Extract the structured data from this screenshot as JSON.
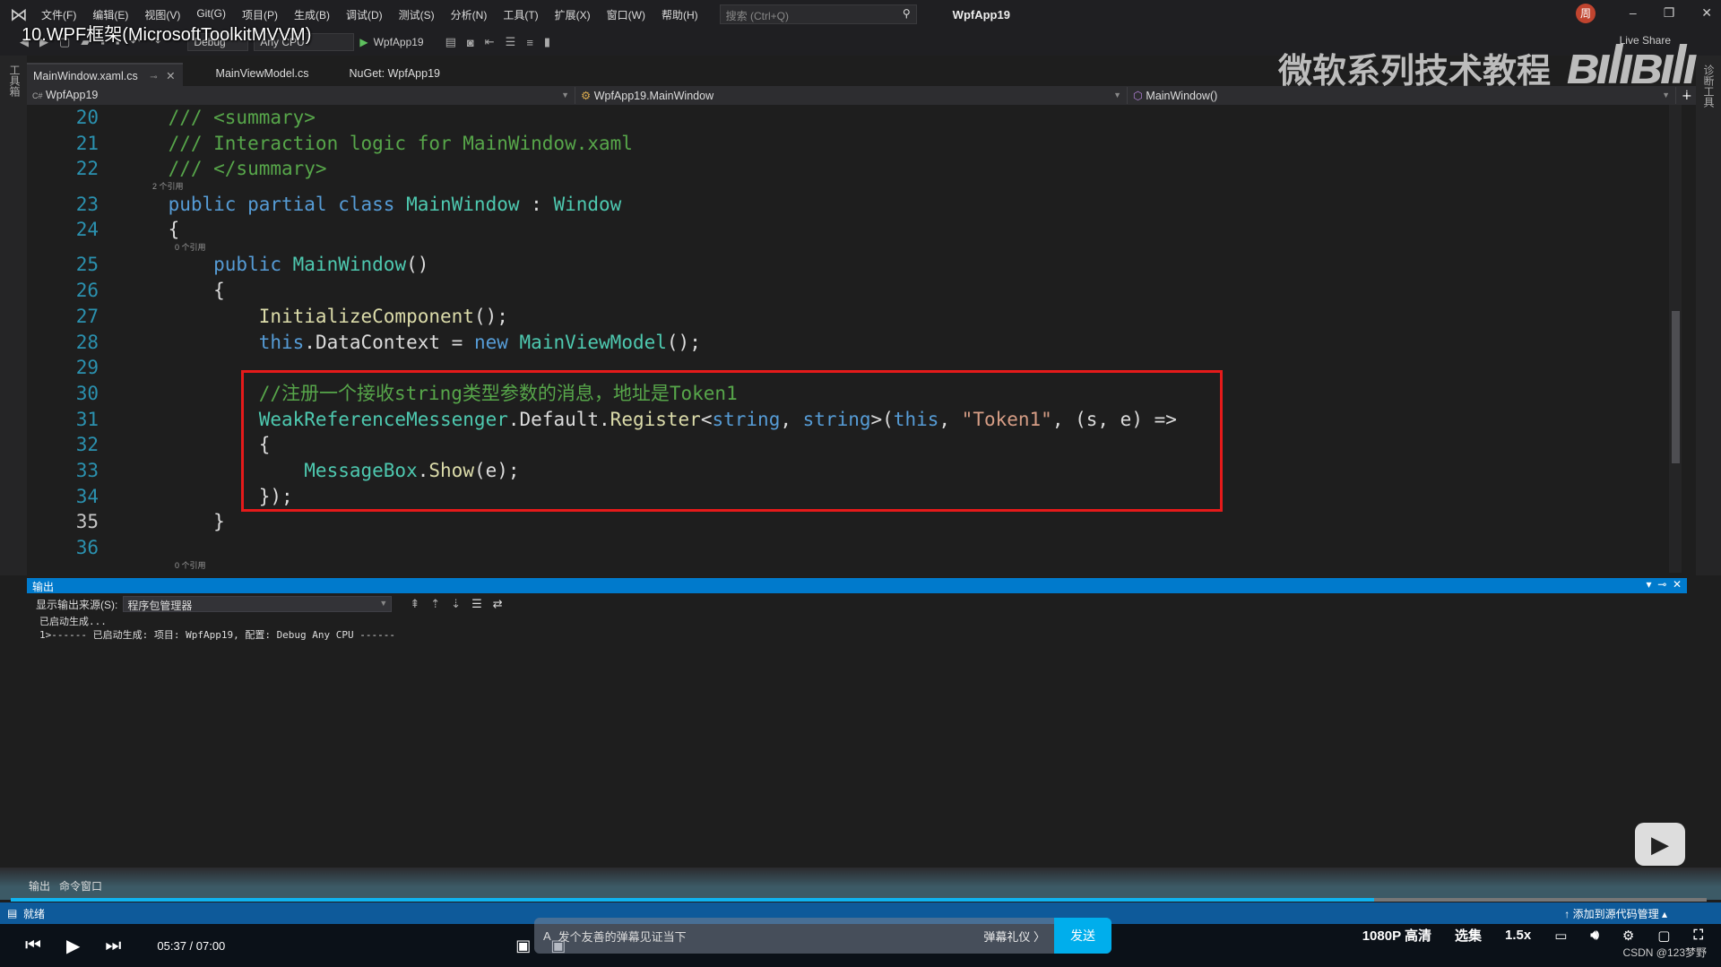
{
  "menubar": {
    "items": [
      "文件(F)",
      "编辑(E)",
      "视图(V)",
      "Git(G)",
      "项目(P)",
      "生成(B)",
      "调试(D)",
      "测试(S)",
      "分析(N)",
      "工具(T)",
      "扩展(X)",
      "窗口(W)",
      "帮助(H)"
    ],
    "search_placeholder": "搜索 (Ctrl+Q)",
    "app_title": "WpfApp19",
    "avatar": "周"
  },
  "video_title": "10.WPF框架(MicrosoftToolkitMVVM)",
  "watermark": "微软系列技术教程",
  "bili_logo": "bilibili",
  "toolbar": {
    "config": "Debug",
    "platform": "Any CPU",
    "run": "WpfApp19",
    "live_share": "Live Share"
  },
  "left_toolbox": "工具箱",
  "right_tool": "诊断工具",
  "tabs": [
    {
      "label": "MainWindow.xaml.cs",
      "active": true
    },
    {
      "label": "MainViewModel.cs"
    },
    {
      "label": "NuGet: WpfApp19"
    }
  ],
  "navbar": {
    "project": "WpfApp19",
    "class": "WpfApp19.MainWindow",
    "member": "MainWindow()"
  },
  "code": {
    "lines": [
      {
        "n": "20",
        "tokens": [
          [
            "cm",
            "    /// <summary>"
          ]
        ]
      },
      {
        "n": "21",
        "tokens": [
          [
            "cm",
            "    /// Interaction logic for MainWindow.xaml"
          ]
        ]
      },
      {
        "n": "22",
        "tokens": [
          [
            "cm",
            "    /// </summary>"
          ]
        ],
        "lens_after": "        2 个引用"
      },
      {
        "n": "23",
        "tokens": [
          [
            "kw",
            "    public partial class "
          ],
          [
            "ty",
            "MainWindow"
          ],
          [
            "pl",
            " : "
          ],
          [
            "ty",
            "Window"
          ]
        ]
      },
      {
        "n": "24",
        "tokens": [
          [
            "pl",
            "    {"
          ]
        ],
        "lens_after": "                  0 个引用"
      },
      {
        "n": "25",
        "tokens": [
          [
            "kw",
            "        public "
          ],
          [
            "ty",
            "MainWindow"
          ],
          [
            "pl",
            "()"
          ]
        ]
      },
      {
        "n": "26",
        "tokens": [
          [
            "pl",
            "        {"
          ]
        ]
      },
      {
        "n": "27",
        "tokens": [
          [
            "me",
            "            InitializeComponent"
          ],
          [
            "pl",
            "();"
          ]
        ]
      },
      {
        "n": "28",
        "tokens": [
          [
            "kw",
            "            this"
          ],
          [
            "pl",
            ".DataContext = "
          ],
          [
            "kw",
            "new "
          ],
          [
            "ty",
            "MainViewModel"
          ],
          [
            "pl",
            "();"
          ]
        ]
      },
      {
        "n": "29",
        "tokens": [
          [
            "pl",
            " "
          ]
        ]
      },
      {
        "n": "30",
        "tokens": [
          [
            "cm",
            "            //注册一个接收string类型参数的消息，地址是Token1"
          ]
        ]
      },
      {
        "n": "31",
        "tokens": [
          [
            "ty",
            "            WeakReferenceMessenger"
          ],
          [
            "pl",
            ".Default."
          ],
          [
            "me",
            "Register"
          ],
          [
            "pl",
            "<"
          ],
          [
            "kw",
            "string"
          ],
          [
            "pl",
            ", "
          ],
          [
            "kw",
            "string"
          ],
          [
            "pl",
            ">("
          ],
          [
            "kw",
            "this"
          ],
          [
            "pl",
            ", "
          ],
          [
            "st",
            "\"Token1\""
          ],
          [
            "pl",
            ", (s, e) =>"
          ]
        ]
      },
      {
        "n": "32",
        "tokens": [
          [
            "pl",
            "            {"
          ]
        ]
      },
      {
        "n": "33",
        "tokens": [
          [
            "ty",
            "                MessageBox"
          ],
          [
            "pl",
            "."
          ],
          [
            "me",
            "Show"
          ],
          [
            "pl",
            "(e);"
          ]
        ]
      },
      {
        "n": "34",
        "tokens": [
          [
            "pl",
            "            });"
          ]
        ]
      },
      {
        "n": "35",
        "tokens": [
          [
            "pl",
            "        }"
          ]
        ]
      },
      {
        "n": "36",
        "tokens": [
          [
            "pl",
            " "
          ]
        ],
        "lens_after": "                  0 个引用"
      }
    ]
  },
  "output": {
    "title": "输出",
    "source_label": "显示输出来源(S):",
    "source_value": "程序包管理器",
    "lines": [
      "已启动生成...",
      "1>------ 已启动生成: 项目: WpfApp19, 配置: Debug Any CPU ------"
    ],
    "bottom_tabs": [
      "输出",
      "命令窗口"
    ]
  },
  "statusbar": {
    "status": "就绪",
    "source_control": "添加到源代码管理"
  },
  "player": {
    "current": "05:37",
    "total": "07:00",
    "time": "05:37 / 07:00",
    "progress": 0.804,
    "danmu_placeholder": "发个友善的弹幕见证当下",
    "gift": "弹幕礼仪 〉",
    "send": "发送",
    "quality": "1080P 高清",
    "episodes": "选集",
    "speed": "1.5x",
    "credit": "CSDN @123梦野"
  },
  "colors": {
    "accent": "#007acc",
    "highlight_box": "#e51a1a",
    "bili_blue": "#00aeec"
  }
}
